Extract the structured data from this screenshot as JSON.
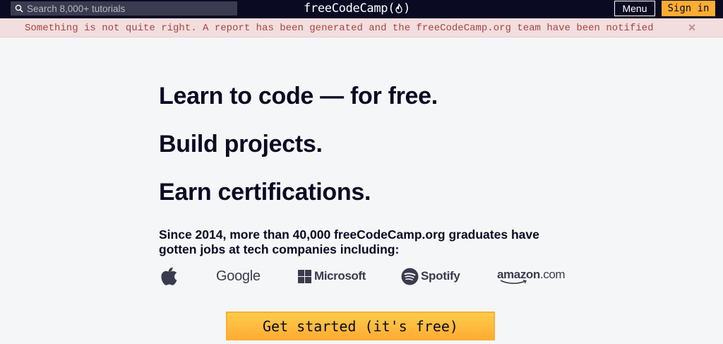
{
  "nav": {
    "search_placeholder": "Search 8,000+ tutorials",
    "brand_text": "freeCodeCamp",
    "brand_open_paren": "(",
    "brand_close_paren": ")",
    "menu_label": "Menu",
    "signin_label": "Sign in"
  },
  "alert": {
    "message": "Something is not quite right. A report has been generated and the freeCodeCamp.org team have been notified",
    "close_glyph": "×"
  },
  "hero": {
    "headline_1": "Learn to code — for free.",
    "headline_2": "Build projects.",
    "headline_3": "Earn certifications.",
    "subtext": "Since 2014, more than 40,000 freeCodeCamp.org graduates have gotten jobs at tech companies including:"
  },
  "logos": {
    "apple": {
      "icon": "apple-logo-icon"
    },
    "google": {
      "text": "Google"
    },
    "microsoft": {
      "text": "Microsoft",
      "icon": "windows-tiles-icon"
    },
    "spotify": {
      "text": "Spotify",
      "icon": "spotify-logo-icon"
    },
    "amazon": {
      "brand": "amazon",
      "suffix": ".com"
    }
  },
  "cta": {
    "label": "Get started (it's free)"
  },
  "colors": {
    "nav_bg": "#0a0a23",
    "search_bg": "#3b3b4f",
    "accent_yellow": "#feac32",
    "alert_bg": "#f2dede",
    "alert_text": "#a94442",
    "page_bg": "#f5f6f7",
    "heading": "#0a0a23",
    "logo_gray": "#3b3b4f"
  }
}
